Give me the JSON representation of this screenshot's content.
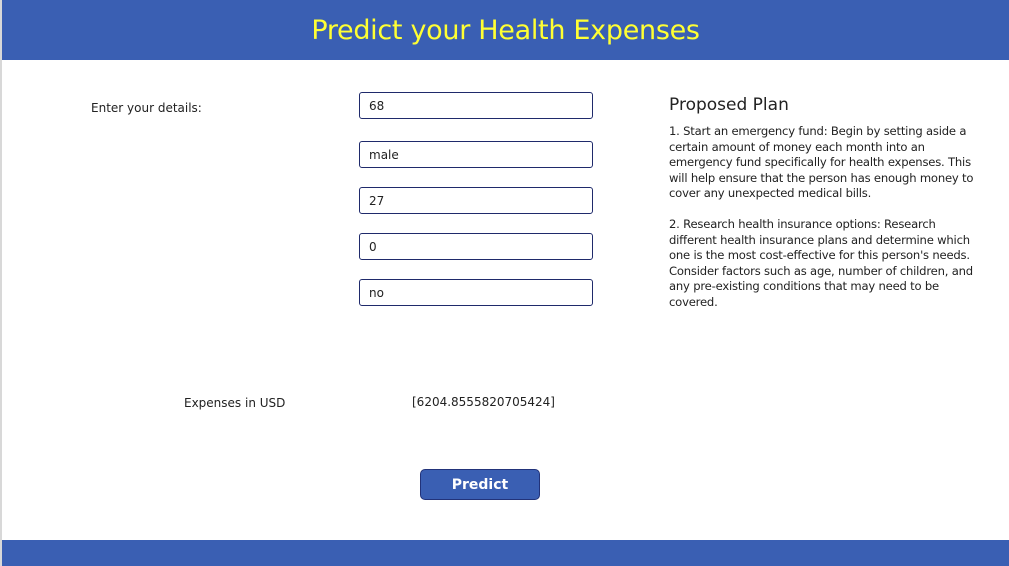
{
  "header": {
    "title": "Predict your Health Expenses"
  },
  "form": {
    "label": "Enter your details:",
    "fields": [
      "68",
      "male",
      "27",
      "0",
      "no"
    ]
  },
  "plan": {
    "title": "Proposed Plan",
    "body": "1. Start an emergency fund: Begin by setting aside a\ncertain amount of money each month into an\nemergency fund specifically for health expenses. This\nwill help ensure that the person has enough money to\ncover any unexpected medical bills.\n\n2. Research health insurance options: Research\ndifferent health insurance plans and determine which\none is the most cost-effective for this person's needs.\nConsider factors such as age, number of children, and\nany pre-existing conditions that may need to be\ncovered."
  },
  "result": {
    "label": "Expenses in USD",
    "value": "[6204.8555820705424]"
  },
  "actions": {
    "predict_label": "Predict"
  },
  "colors": {
    "header_bg": "#3a5fb3",
    "title": "#ffff33",
    "field_border": "#1f2a6b"
  }
}
